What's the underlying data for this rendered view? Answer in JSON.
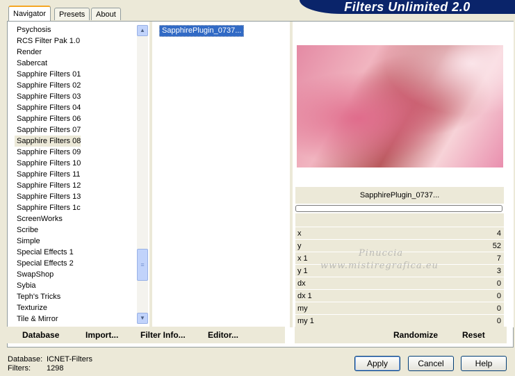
{
  "tabs": [
    {
      "label": "Navigator"
    },
    {
      "label": "Presets"
    },
    {
      "label": "About"
    }
  ],
  "app_title": "Filters Unlimited 2.0",
  "filter_categories": [
    {
      "label": "Psychosis"
    },
    {
      "label": "RCS Filter Pak 1.0"
    },
    {
      "label": "Render"
    },
    {
      "label": "Sabercat"
    },
    {
      "label": "Sapphire Filters 01"
    },
    {
      "label": "Sapphire Filters 02"
    },
    {
      "label": "Sapphire Filters 03"
    },
    {
      "label": "Sapphire Filters 04"
    },
    {
      "label": "Sapphire Filters 06"
    },
    {
      "label": "Sapphire Filters 07"
    },
    {
      "label": "Sapphire Filters 08"
    },
    {
      "label": "Sapphire Filters 09"
    },
    {
      "label": "Sapphire Filters 10"
    },
    {
      "label": "Sapphire Filters 11"
    },
    {
      "label": "Sapphire Filters 12"
    },
    {
      "label": "Sapphire Filters 13"
    },
    {
      "label": "Sapphire Filters 1c"
    },
    {
      "label": "ScreenWorks"
    },
    {
      "label": "Scribe"
    },
    {
      "label": "Simple"
    },
    {
      "label": "Special Effects 1"
    },
    {
      "label": "Special Effects 2"
    },
    {
      "label": "SwapShop"
    },
    {
      "label": "Sybia"
    },
    {
      "label": "Teph's Tricks"
    },
    {
      "label": "Texturize"
    },
    {
      "label": "Tile & Mirror"
    }
  ],
  "selected_category": "Sapphire Filters 08",
  "selected_filter": "SapphirePlugin_0737...",
  "preview_title": "SapphirePlugin_0737...",
  "params": [
    {
      "name": "x",
      "value": "4"
    },
    {
      "name": "y",
      "value": "52"
    },
    {
      "name": "x 1",
      "value": "7"
    },
    {
      "name": "y 1",
      "value": "3"
    },
    {
      "name": "dx",
      "value": "0"
    },
    {
      "name": "dx 1",
      "value": "0"
    },
    {
      "name": "my",
      "value": "0"
    },
    {
      "name": "my 1",
      "value": "0"
    }
  ],
  "toolbar": {
    "database": "Database",
    "import": "Import...",
    "filter_info": "Filter Info...",
    "editor": "Editor...",
    "randomize": "Randomize",
    "reset": "Reset"
  },
  "status": {
    "database_label": "Database:",
    "database_value": "ICNET-Filters",
    "filters_label": "Filters:",
    "filters_value": "1298"
  },
  "dialog": {
    "apply": "Apply",
    "cancel": "Cancel",
    "help": "Help"
  },
  "watermark": {
    "line1": "Pinuccia",
    "line2": "www.mistiregrafica.eu"
  }
}
